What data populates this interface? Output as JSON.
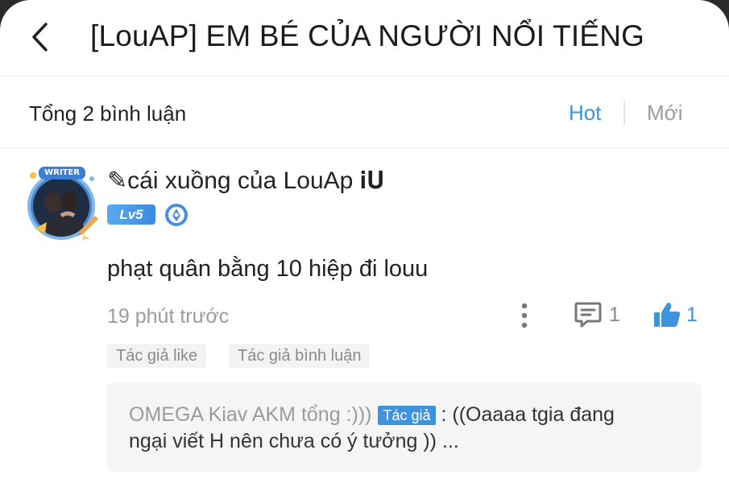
{
  "header": {
    "title": "[LouAP] EM BÉ CỦA NGƯỜI NỔI TIẾNG",
    "back_icon": "chevron-left-icon"
  },
  "comments_bar": {
    "count_label": "Tổng 2 bình luận",
    "sort_hot": "Hot",
    "sort_new": "Mới",
    "active_color": "#3e93df"
  },
  "comment": {
    "username": "✎cái xuồng của LouAp 𝐢𝐔",
    "avatar_badge": "WRITER",
    "level": "Lv5",
    "text": "phạt quân bằng 10 hiệp đi louu",
    "time": "19 phút trước",
    "reply_count": "1",
    "like_count": "1",
    "tags": [
      "Tác giả like",
      "Tác giả bình luận"
    ],
    "reply": {
      "user": "OMEGA Kiav AKM tổng :)))",
      "badge": "Tác giả",
      "text_start": ": ((Oaaaa tgia đang",
      "text_end": "ngại viết H nên chưa có ý tưởng )) ..."
    }
  }
}
